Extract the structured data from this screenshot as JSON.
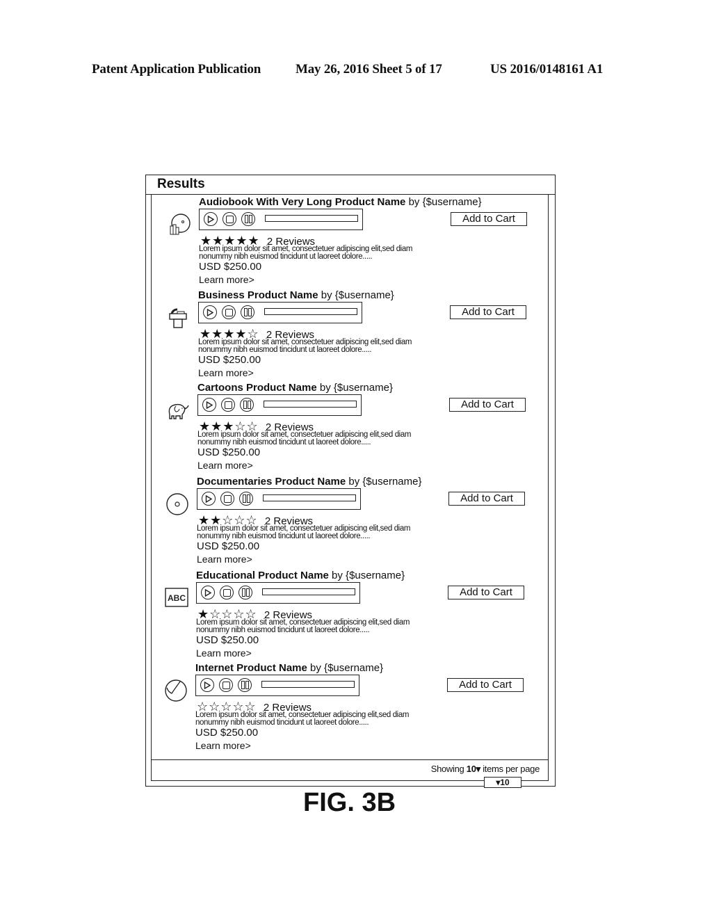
{
  "page_header": {
    "left": "Patent Application Publication",
    "middle": "May 26, 2016  Sheet 5 of 17",
    "right": "US 2016/0148161 A1"
  },
  "panel": {
    "title": "Results",
    "add_to_cart_label": "Add to Cart",
    "items": [
      {
        "name": "Audiobook With Very Long Product Name",
        "by": "by {$username}",
        "icon": "audiobook-icon",
        "rating": 5,
        "max_rating": 5,
        "stars": "★★★★★",
        "reviews": "2 Reviews",
        "description": "Lorem ipsum dolor sit amet, consectetuer adipiscing elit,sed diam nonummy nibh euismod tincidunt ut laoreet dolore.....",
        "price": "USD $250.00",
        "learn_more": "Learn more>",
        "add_to_cart": "Add to Cart"
      },
      {
        "name": "Business Product Name",
        "by": "by {$username}",
        "icon": "business-icon",
        "rating": 4,
        "max_rating": 5,
        "stars": "★★★★☆",
        "reviews": "2 Reviews",
        "description": "Lorem ipsum dolor sit amet, consectetuer adipiscing elit,sed diam nonummy nibh euismod tincidunt ut laoreet dolore.....",
        "price": "USD $250.00",
        "learn_more": "Learn more>",
        "add_to_cart": "Add to Cart"
      },
      {
        "name": "Cartoons Product Name",
        "by": "by {$username}",
        "icon": "elephant-icon",
        "rating": 3,
        "max_rating": 5,
        "stars": "★★★☆☆",
        "reviews": "2 Reviews",
        "description": "Lorem ipsum dolor sit amet, consectetuer adipiscing elit,sed diam nonummy nibh euismod tincidunt ut laoreet dolore.....",
        "price": "USD $250.00",
        "learn_more": "Learn more>",
        "add_to_cart": "Add to Cart"
      },
      {
        "name": "Documentaries Product Name",
        "by": "by {$username}",
        "icon": "disc-icon",
        "rating": 2,
        "max_rating": 5,
        "stars": "★★☆☆☆",
        "reviews": "2 Reviews",
        "description": "Lorem ipsum dolor sit amet, consectetuer adipiscing elit,sed diam nonummy nibh euismod tincidunt ut laoreet dolore.....",
        "price": "USD $250.00",
        "learn_more": "Learn more>",
        "add_to_cart": "Add to Cart"
      },
      {
        "name": "Educational Product Name",
        "by": "by {$username}",
        "icon": "abc-icon",
        "icon_text": "ABC",
        "rating": 1,
        "max_rating": 5,
        "stars": "★☆☆☆☆",
        "reviews": "2 Reviews",
        "description": "Lorem ipsum dolor sit amet, consectetuer adipiscing elit,sed diam nonummy nibh euismod tincidunt ut laoreet dolore.....",
        "price": "USD $250.00",
        "learn_more": "Learn more>",
        "add_to_cart": "Add to Cart"
      },
      {
        "name": "Internet Product Name",
        "by": "by {$username}",
        "icon": "globe-icon",
        "rating": 0,
        "max_rating": 5,
        "stars": "☆☆☆☆☆",
        "reviews": "2 Reviews",
        "description": "Lorem ipsum dolor sit amet, consectetuer adipiscing elit,sed diam nonummy nibh euismod tincidunt ut laoreet dolore.....",
        "price": "USD $250.00",
        "learn_more": "Learn more>",
        "add_to_cart": "Add to Cart"
      }
    ],
    "footer": {
      "showing_prefix": "Showing",
      "showing_value": "10▾",
      "showing_suffix": "items per page",
      "per_page_select": "▾10"
    }
  },
  "figure_label": "FIG. 3B"
}
